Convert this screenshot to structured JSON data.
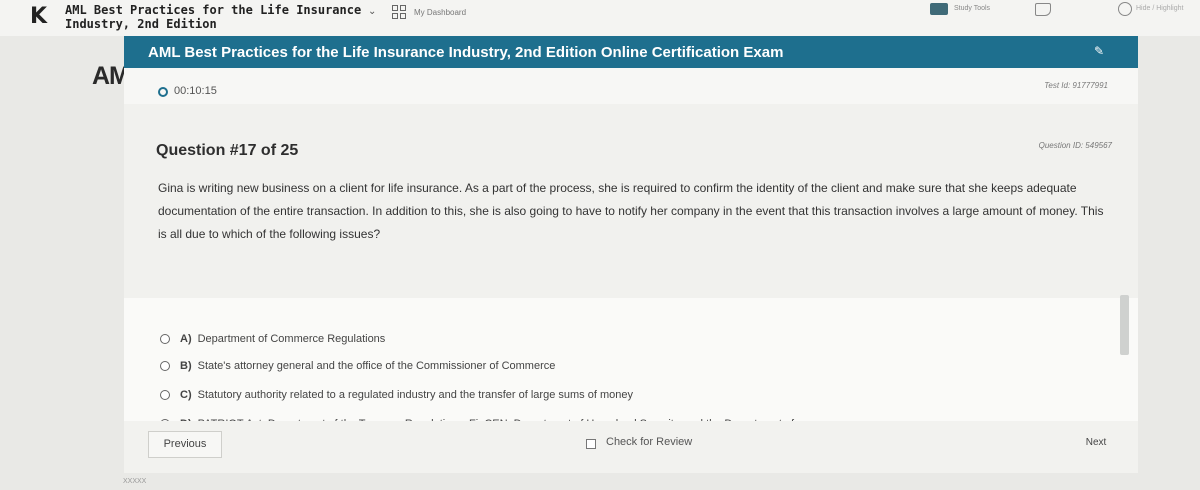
{
  "app": {
    "course_title_line1": "AML Best Practices for the Life Insurance",
    "course_title_line2": "Industry, 2nd Edition",
    "dashboard_link": "My Dashboard",
    "study_tools": "Study Tools",
    "top_right_text": "Hide / Highlight",
    "background_text": "AM",
    "bottom_note": "XXXXX"
  },
  "exam": {
    "title": "AML Best Practices for the Life Insurance Industry, 2nd Edition Online Certification Exam",
    "timer": "00:10:15",
    "test_id": "Test Id: 91777991",
    "question_number": "Question #17 of 25",
    "question_id": "Question ID: 549567",
    "question_text": "Gina is writing new business on a client for life insurance. As a part of the process, she is required to confirm the identity of the client and make sure that she keeps adequate documentation of the entire transaction. In addition to this, she is also going to have to notify her company in the event that this transaction involves a large amount of money. This is all due to which of the following issues?",
    "answers": [
      {
        "letter": "A)",
        "text": "Department of Commerce Regulations"
      },
      {
        "letter": "B)",
        "text": "State's attorney general and the office of the Commissioner of Commerce"
      },
      {
        "letter": "C)",
        "text": "Statutory authority related to a regulated industry and the transfer of large sums of money"
      },
      {
        "letter": "D)",
        "text": "PATRIOT Act, Department of the Treasury Regulations, FinCEN, Department of Homeland Security, and the Department of"
      }
    ],
    "previous_label": "Previous",
    "review_label": "Check for Review",
    "next_label": "Next"
  }
}
